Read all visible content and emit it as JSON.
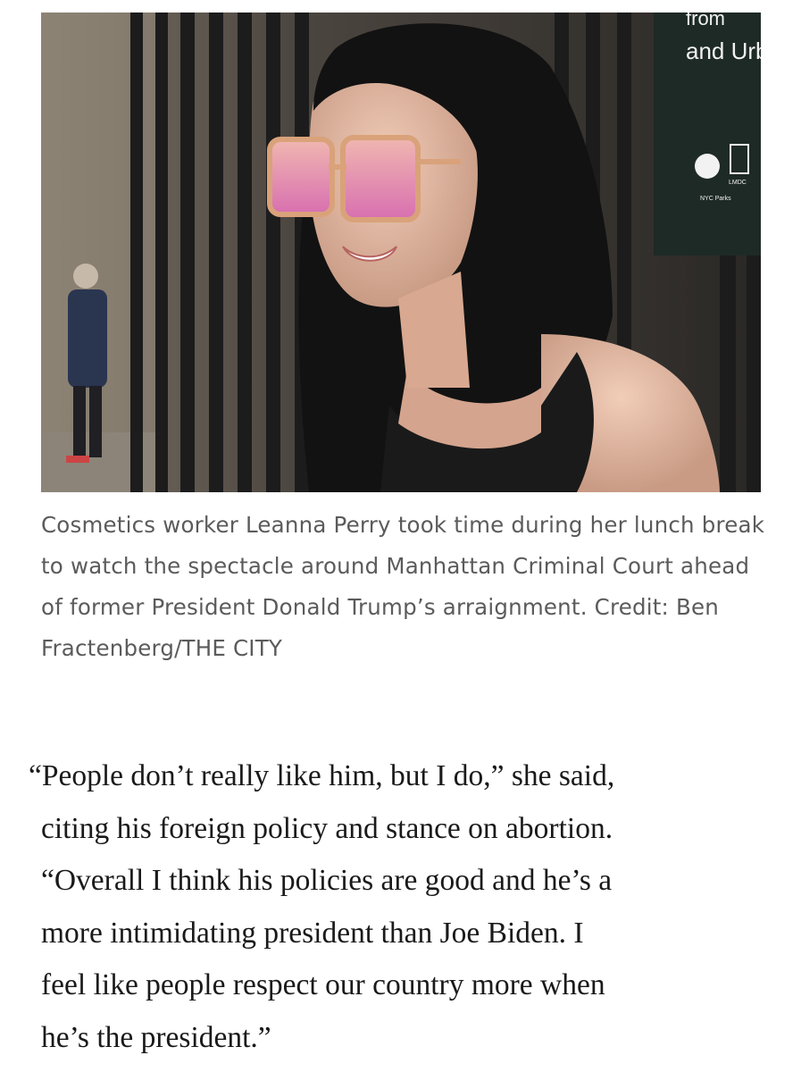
{
  "photo": {
    "sign_text_line1": "from",
    "sign_text_line2": "and Urba",
    "sign_logo_text": "NYC Parks",
    "sign_logo2_text": "LMDC"
  },
  "caption": {
    "text": "Cosmetics worker Leanna Perry took time during her lunch break to watch the spectacle around Manhattan Criminal Court ahead of former President Donald Trump’s arraignment. Credit: Ben Fractenberg/THE CITY"
  },
  "quote": {
    "lines": [
      "“People don’t really like him, but I do,” she said,",
      "citing his foreign policy and stance on abortion.",
      "“Overall I think his policies are good and he’s a",
      "more intimidating president than Joe Biden. I",
      "feel like people respect our country more when",
      "he’s the president.”"
    ]
  }
}
